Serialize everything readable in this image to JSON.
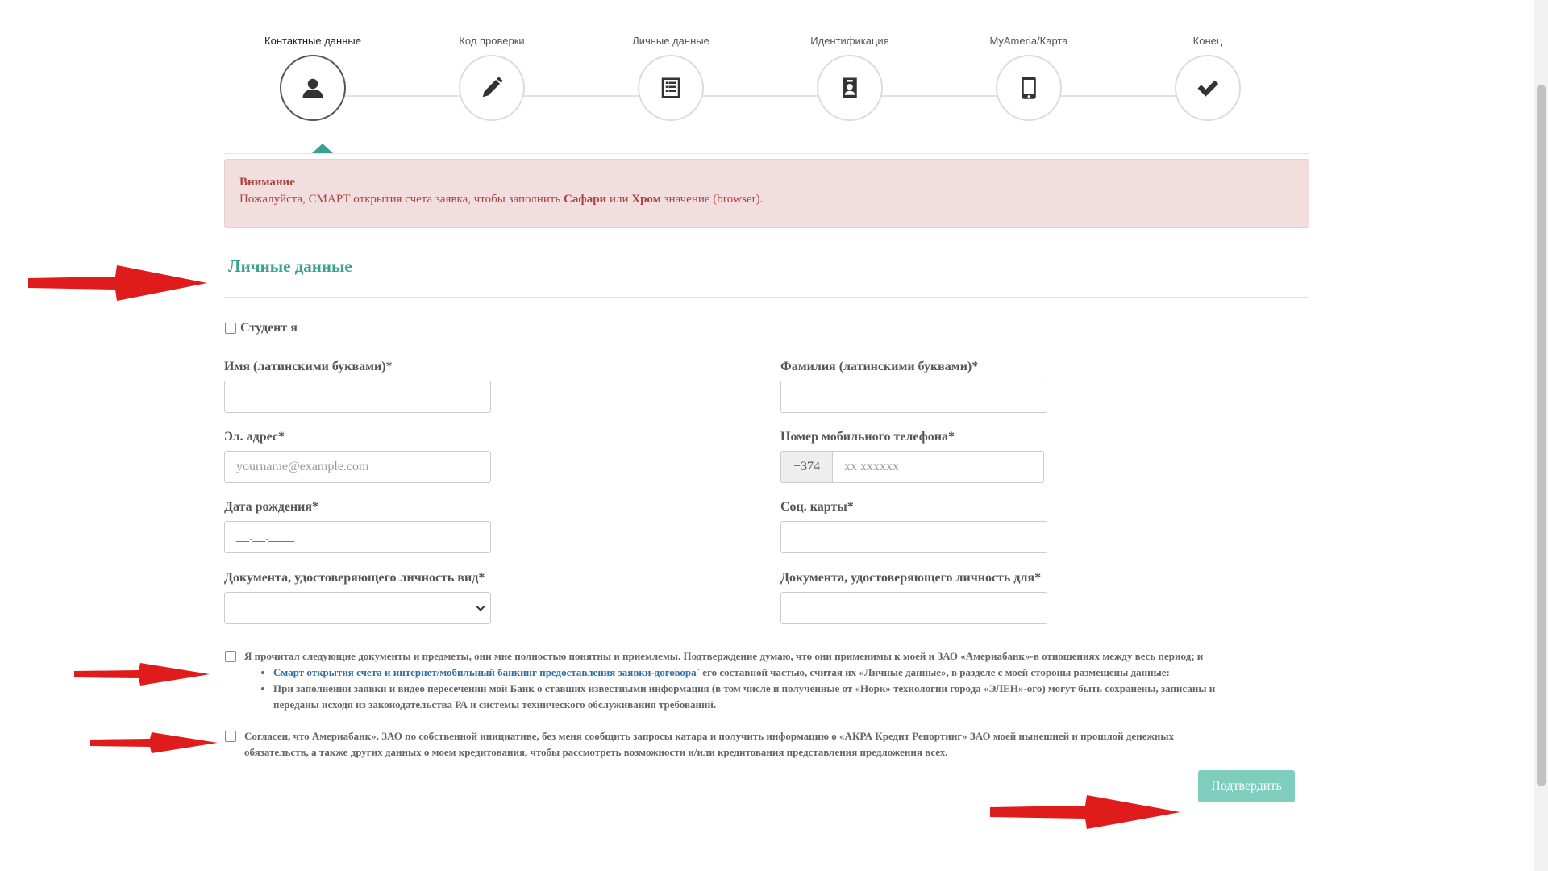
{
  "stepper": {
    "steps": [
      {
        "label": "Контактные данные",
        "icon": "user-icon",
        "active": true
      },
      {
        "label": "Код проверки",
        "icon": "pencil-icon",
        "active": false
      },
      {
        "label": "Личные данные",
        "icon": "list-icon",
        "active": false
      },
      {
        "label": "Идентификация",
        "icon": "id-badge-icon",
        "active": false
      },
      {
        "label": "MyAmeria/Карта",
        "icon": "mobile-icon",
        "active": false
      },
      {
        "label": "Конец",
        "icon": "check-icon",
        "active": false
      }
    ]
  },
  "alert": {
    "title": "Внимание",
    "text_before": "Пожалуйста, СМАРТ открытия счета заявка, чтобы заполнить ",
    "browser1": "Сафари",
    "text_mid": " или ",
    "browser2": "Хром",
    "text_after": " значение (browser)."
  },
  "section": {
    "title": "Личные данные"
  },
  "form": {
    "student_label": "Студент я",
    "first_name": {
      "label": "Имя (латинскими буквами)*",
      "value": ""
    },
    "last_name": {
      "label": "Фамилия (латинскими буквами)*",
      "value": ""
    },
    "email": {
      "label": "Эл. адрес*",
      "placeholder": "yourname@example.com"
    },
    "phone": {
      "label": "Номер мобильного телефона*",
      "prefix": "+374",
      "placeholder": "xx xxxxxx"
    },
    "birth_date": {
      "label": "Дата рождения*",
      "mask": "__.__.____"
    },
    "social_card": {
      "label": "Соц. карты*",
      "value": ""
    },
    "id_doc_type": {
      "label": "Документа, удостоверяющего личность вид*",
      "selected": ""
    },
    "id_doc_number": {
      "label": "Документа, удостоверяющего личность для*",
      "value": ""
    }
  },
  "consents": {
    "first": {
      "text": "Я прочитал следующие документы и предметы, они мне полностью понятны и приемлемы. Подтверждение думаю, что они применимы к моей и ЗАО «Америабанк»-в отношениях между весь период; и",
      "item1_link": "Смарт открытия счета и интернет/мобильный банкинг предоставления заявки-договора`",
      "item1_text": " его составной частью, считая их «Личные данные», в разделе с моей стороны размещены данные:",
      "item2_line1": "При заполнении заявки и видео пересечении мой Банк о ставших известными информация (в том числе и полученные от «Норк» технологии города «ЭЛЕН»-ого) могут быть сохранены, записаны и",
      "item2_line2": "переданы исходя из законодательства РА и системы технического обслуживания требований."
    },
    "second": {
      "line1": "Согласен, что Америабанк», ЗАО по собственной инициативе, без меня сообщить запросы катара и получить информацию о «АКРА Кредит Репортинг» ЗАО моей нынешней и прошлой денежных",
      "line2": "обязательств, а также других данных о моем кредитования, чтобы рассмотреть возможности и/или кредитования представления предложения всех."
    }
  },
  "submit_label": "Подтвердить",
  "colors": {
    "accent": "#3aa08f",
    "button": "#7fcdbc",
    "alert_bg": "#f2dede",
    "alert_text": "#a94442",
    "annotation": "#e01b1b"
  }
}
